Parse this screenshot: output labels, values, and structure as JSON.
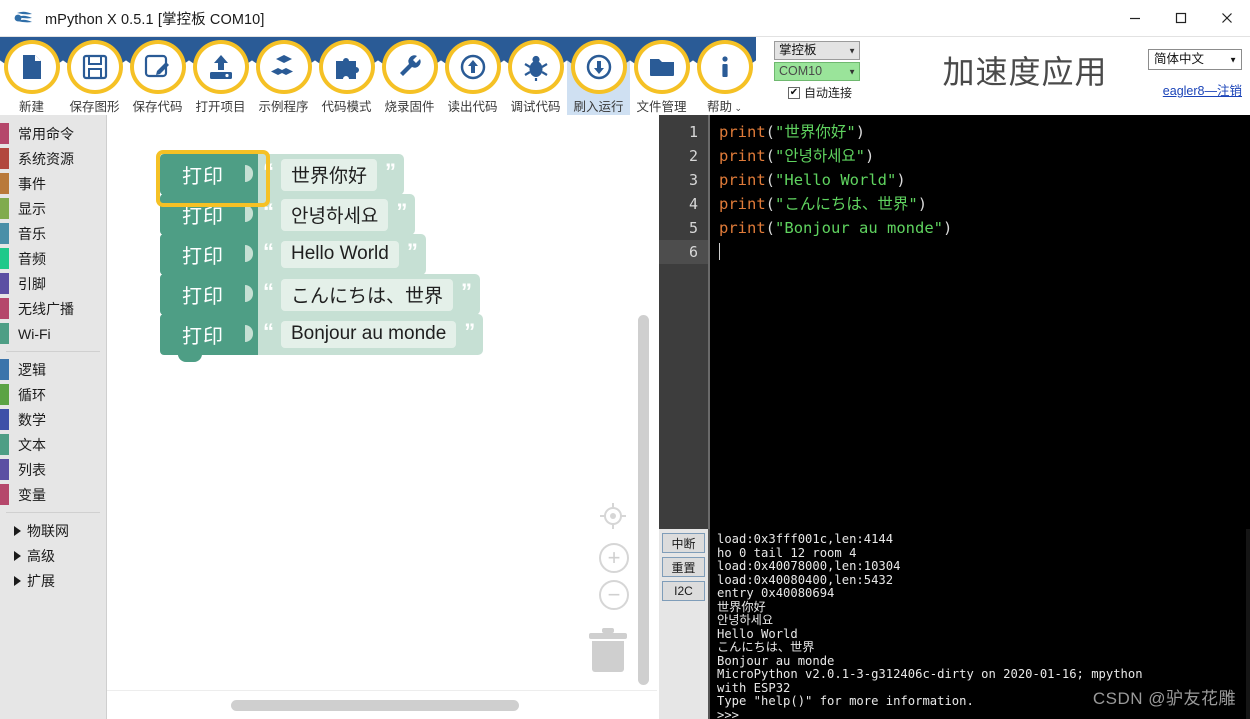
{
  "window": {
    "title": "mPython X 0.5.1 [掌控板 COM10]",
    "logo_icon": "mpython-logo-icon",
    "minimize_label": "minimize",
    "maximize_label": "maximize",
    "close_label": "close"
  },
  "toolbar": {
    "items": [
      {
        "label": "新建",
        "icon": "new-file-icon",
        "active": false,
        "caret": ""
      },
      {
        "label": "保存图形",
        "icon": "save-blocks-icon",
        "active": false,
        "caret": ""
      },
      {
        "label": "保存代码",
        "icon": "save-code-icon",
        "active": false,
        "caret": ""
      },
      {
        "label": "打开项目",
        "icon": "open-project-icon",
        "active": false,
        "caret": ""
      },
      {
        "label": "示例程序",
        "icon": "examples-icon",
        "active": false,
        "caret": ""
      },
      {
        "label": "代码模式",
        "icon": "code-mode-icon",
        "active": false,
        "caret": ""
      },
      {
        "label": "烧录固件",
        "icon": "burn-firmware-icon",
        "active": false,
        "caret": ""
      },
      {
        "label": "读出代码",
        "icon": "read-code-icon",
        "active": false,
        "caret": ""
      },
      {
        "label": "调试代码",
        "icon": "debug-code-icon",
        "active": false,
        "caret": ""
      },
      {
        "label": "刷入运行",
        "icon": "flash-run-icon",
        "active": true,
        "caret": ""
      },
      {
        "label": "文件管理",
        "icon": "file-manager-icon",
        "active": false,
        "caret": ""
      },
      {
        "label": "帮助",
        "icon": "help-icon",
        "active": false,
        "caret": "⌄"
      }
    ]
  },
  "device": {
    "board_value": "掌控板",
    "port_value": "COM10",
    "auto_connect_label": "自动连接",
    "auto_connect_checked": true,
    "check_glyph": "✔"
  },
  "app": {
    "title": "加速度应用",
    "language_value": "简体中文",
    "user_link": "eagler8—注销"
  },
  "categories": [
    {
      "label": "常用命令",
      "color": "#b5476b"
    },
    {
      "label": "系统资源",
      "color": "#b2483f"
    },
    {
      "label": "事件",
      "color": "#b9793a"
    },
    {
      "label": "显示",
      "color": "#80ab4e"
    },
    {
      "label": "音乐",
      "color": "#4a8fa8"
    },
    {
      "label": "音频",
      "color": "#1fc98a"
    },
    {
      "label": "引脚",
      "color": "#5c4fa3"
    },
    {
      "label": "无线广播",
      "color": "#b5476b"
    },
    {
      "label": "Wi-Fi",
      "color": "#4e9e85"
    }
  ],
  "categories2": [
    {
      "label": "逻辑",
      "color": "#3b74ab"
    },
    {
      "label": "循环",
      "color": "#5ba344"
    },
    {
      "label": "数学",
      "color": "#3f51a8"
    },
    {
      "label": "文本",
      "color": "#4e9e85"
    },
    {
      "label": "列表",
      "color": "#5c4fa3"
    },
    {
      "label": "变量",
      "color": "#b5476b"
    }
  ],
  "categories_tree": [
    {
      "label": "物联网",
      "expander": "▶"
    },
    {
      "label": "高级",
      "expander": "▶"
    },
    {
      "label": "扩展",
      "expander": "▶"
    }
  ],
  "blocks": {
    "print_label": "打印",
    "open_quote": "“",
    "close_quote": "”",
    "items": [
      {
        "text": "世界你好",
        "selected": true
      },
      {
        "text": "안녕하세요",
        "selected": false
      },
      {
        "text": "Hello World",
        "selected": false
      },
      {
        "text": "こんにちは、世界",
        "selected": false
      },
      {
        "text": "Bonjour au monde",
        "selected": false
      }
    ],
    "controls": {
      "center_icon": "center-target-icon",
      "zoom_in_label": "+",
      "zoom_out_label": "−",
      "trash_icon": "trash-icon"
    }
  },
  "editor": {
    "line_numbers": [
      "1",
      "2",
      "3",
      "4",
      "5",
      "6"
    ],
    "current_line": 6,
    "lines": [
      {
        "fn": "print",
        "open": "(\"",
        "str": "世界你好",
        "close": "\")"
      },
      {
        "fn": "print",
        "open": "(\"",
        "str": "안녕하세요",
        "close": "\")"
      },
      {
        "fn": "print",
        "open": "(\"",
        "str": "Hello World",
        "close": "\")"
      },
      {
        "fn": "print",
        "open": "(\"",
        "str": "こんにちは、世界",
        "close": "\")"
      },
      {
        "fn": "print",
        "open": "(\"",
        "str": "Bonjour au monde",
        "close": "\")"
      }
    ]
  },
  "terminal": {
    "buttons": [
      {
        "label": "中断"
      },
      {
        "label": "重置"
      },
      {
        "label": "I2C"
      }
    ],
    "output": "load:0x3fff001c,len:4144\nho 0 tail 12 room 4\nload:0x40078000,len:10304\nload:0x40080400,len:5432\nentry 0x40080694\n世界你好\n안녕하세요\nHello World\nこんにちは、世界\nBonjour au monde\nMicroPython v2.0.1-3-g312406c-dirty on 2020-01-16; mpython\nwith ESP32\nType \"help()\" for more information.\n>>>",
    "watermark": "CSDN @驴友花雕"
  },
  "colors": {
    "toolbar_ring": "#f5c125",
    "toolbar_zig": "#2a5b96",
    "block_body": "#4e9e85",
    "block_field": "#c6e0d4",
    "selection": "#f5c125",
    "port_green": "#9ae49a",
    "code_string": "#5fd35f",
    "code_function": "#e07b39"
  }
}
